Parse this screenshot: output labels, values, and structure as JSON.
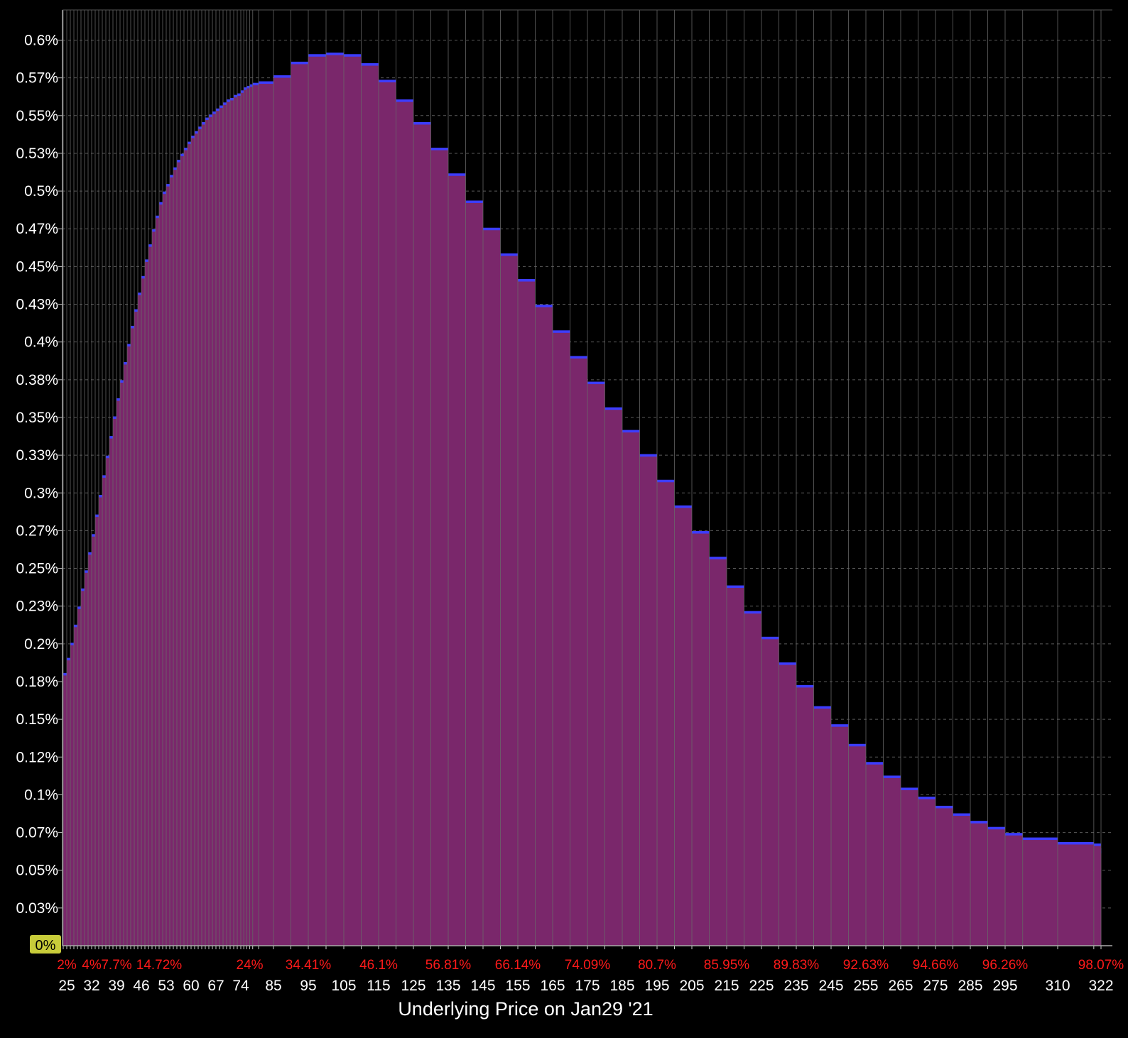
{
  "colors": {
    "background": "#000000",
    "fill": "#7a276b",
    "cap": "#3d3dff",
    "grid": "#5a5a5a",
    "cumulative_text": "#ff1a1a",
    "zero_badge": "#c8cc3a"
  },
  "chart_data": {
    "type": "bar",
    "xlabel": "Underlying Price on Jan29 '21",
    "ylabel": "",
    "ylim": [
      0,
      0.62
    ],
    "y_unit": "%",
    "yticks": [
      "0.6%",
      "0.57%",
      "0.55%",
      "0.53%",
      "0.5%",
      "0.47%",
      "0.45%",
      "0.43%",
      "0.4%",
      "0.38%",
      "0.35%",
      "0.33%",
      "0.3%",
      "0.27%",
      "0.25%",
      "0.23%",
      "0.2%",
      "0.18%",
      "0.15%",
      "0.12%",
      "0.1%",
      "0.07%",
      "0.05%",
      "0.03%",
      "0%"
    ],
    "ytick_values": [
      0.6,
      0.575,
      0.55,
      0.525,
      0.5,
      0.475,
      0.45,
      0.425,
      0.4,
      0.375,
      0.35,
      0.325,
      0.3,
      0.275,
      0.25,
      0.225,
      0.2,
      0.175,
      0.15,
      0.125,
      0.1,
      0.075,
      0.05,
      0.025,
      0
    ],
    "xticks": [
      "25",
      "32",
      "39",
      "46",
      "53",
      "60",
      "67",
      "74",
      "85",
      "95",
      "105",
      "115",
      "125",
      "135",
      "145",
      "155",
      "165",
      "175",
      "185",
      "195",
      "205",
      "215",
      "225",
      "235",
      "245",
      "255",
      "265",
      "275",
      "285",
      "295",
      "310",
      "322"
    ],
    "cumulative_labels": [
      {
        "x": 25,
        "label": "2%"
      },
      {
        "x": 32,
        "label": "4%"
      },
      {
        "x": 39,
        "label": "7.7%"
      },
      {
        "x": 51,
        "label": "14.72%"
      },
      {
        "x": 77,
        "label": "24%"
      },
      {
        "x": 95,
        "label": "34.41%"
      },
      {
        "x": 115,
        "label": "46.1%"
      },
      {
        "x": 135,
        "label": "56.81%"
      },
      {
        "x": 155,
        "label": "66.14%"
      },
      {
        "x": 175,
        "label": "74.09%"
      },
      {
        "x": 195,
        "label": "80.7%"
      },
      {
        "x": 215,
        "label": "85.95%"
      },
      {
        "x": 235,
        "label": "89.83%"
      },
      {
        "x": 255,
        "label": "92.63%"
      },
      {
        "x": 275,
        "label": "94.66%"
      },
      {
        "x": 295,
        "label": "96.26%"
      },
      {
        "x": 322,
        "label": "98.07%"
      }
    ],
    "strikes": [
      24,
      25,
      26,
      27,
      28,
      29,
      30,
      31,
      32,
      33,
      34,
      35,
      36,
      37,
      38,
      39,
      40,
      41,
      42,
      43,
      44,
      45,
      46,
      47,
      48,
      49,
      50,
      51,
      52,
      53,
      54,
      55,
      56,
      57,
      58,
      59,
      60,
      61,
      62,
      63,
      64,
      65,
      66,
      67,
      68,
      69,
      70,
      71,
      72,
      73,
      74,
      75,
      76,
      77,
      78,
      80,
      85,
      90,
      95,
      100,
      105,
      110,
      115,
      120,
      125,
      130,
      135,
      140,
      145,
      150,
      155,
      160,
      165,
      170,
      175,
      180,
      185,
      190,
      195,
      200,
      205,
      210,
      215,
      220,
      225,
      230,
      235,
      240,
      245,
      250,
      255,
      260,
      265,
      270,
      275,
      280,
      285,
      290,
      295,
      300,
      310,
      320,
      322
    ],
    "values": [
      0.18,
      0.19,
      0.2,
      0.212,
      0.224,
      0.236,
      0.248,
      0.26,
      0.272,
      0.285,
      0.298,
      0.311,
      0.324,
      0.337,
      0.35,
      0.362,
      0.374,
      0.386,
      0.398,
      0.41,
      0.421,
      0.432,
      0.443,
      0.454,
      0.464,
      0.474,
      0.483,
      0.492,
      0.499,
      0.504,
      0.51,
      0.515,
      0.52,
      0.524,
      0.528,
      0.532,
      0.536,
      0.539,
      0.542,
      0.545,
      0.548,
      0.55,
      0.552,
      0.554,
      0.556,
      0.558,
      0.56,
      0.561,
      0.563,
      0.564,
      0.566,
      0.568,
      0.569,
      0.57,
      0.571,
      0.572,
      0.576,
      0.585,
      0.59,
      0.591,
      0.59,
      0.584,
      0.573,
      0.56,
      0.545,
      0.528,
      0.511,
      0.493,
      0.475,
      0.458,
      0.441,
      0.424,
      0.407,
      0.39,
      0.373,
      0.356,
      0.341,
      0.325,
      0.308,
      0.291,
      0.274,
      0.257,
      0.238,
      0.221,
      0.204,
      0.187,
      0.172,
      0.158,
      0.146,
      0.133,
      0.121,
      0.112,
      0.104,
      0.098,
      0.092,
      0.087,
      0.082,
      0.078,
      0.074,
      0.071,
      0.068,
      0.067,
      0.064,
      0.062
    ]
  }
}
